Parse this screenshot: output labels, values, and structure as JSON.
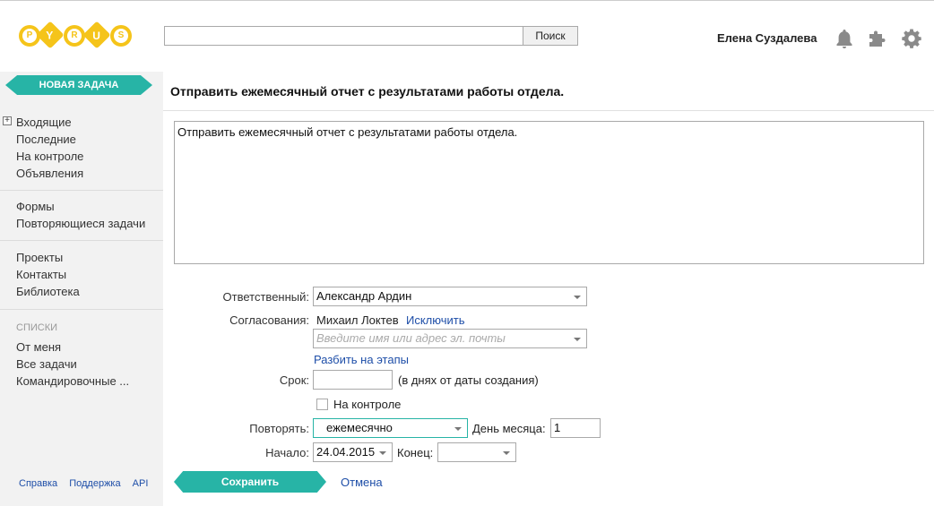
{
  "logo": {
    "letters": [
      "P",
      "Y",
      "R",
      "U",
      "S"
    ],
    "brand_color": "#f5c41a",
    "icon": "pyrus-logo"
  },
  "search": {
    "value": "",
    "button_label": "Поиск"
  },
  "user": {
    "name": "Елена Суздалева"
  },
  "top_icons": [
    "bell-icon",
    "puzzle-icon",
    "gear-icon"
  ],
  "sidebar": {
    "new_task_label": "НОВАЯ ЗАДАЧА",
    "group1": [
      "Входящие",
      "Последние",
      "На контроле",
      "Объявления"
    ],
    "group2": [
      "Формы",
      "Повторяющиеся задачи"
    ],
    "group3": [
      "Проекты",
      "Контакты",
      "Библиотека"
    ],
    "lists_title": "СПИСКИ",
    "group4": [
      "От меня",
      "Все задачи",
      "Командировочные ..."
    ],
    "footer": [
      "Справка",
      "Поддержка",
      "API"
    ]
  },
  "task": {
    "title": "Отправить ежемесячный отчет с результатами работы отдела.",
    "description": "Отправить ежемесячный отчет с результатами работы отдела.",
    "responsible_label": "Ответственный:",
    "responsible_value": "Александр Ардин",
    "approvals_label": "Согласования:",
    "approver": "Михаил Локтев",
    "exclude_link": "Исключить",
    "approver_placeholder": "Введите имя или адрес эл. почты",
    "split_stages_link": "Разбить на этапы",
    "deadline_label": "Срок:",
    "deadline_value": "",
    "deadline_hint": "(в днях от даты создания)",
    "on_control_label": "На контроле",
    "repeat_label": "Повторять:",
    "repeat_value": "ежемесячно",
    "day_of_month_label": "День месяца:",
    "day_of_month_value": "1",
    "start_label": "Начало:",
    "start_value": "24.04.2015",
    "end_label": "Конец:",
    "end_value": "",
    "save_label": "Сохранить",
    "cancel_label": "Отмена"
  },
  "colors": {
    "accent": "#27b4a6",
    "link": "#1e4ea8",
    "sidebar_bg": "#f2f2f2"
  }
}
